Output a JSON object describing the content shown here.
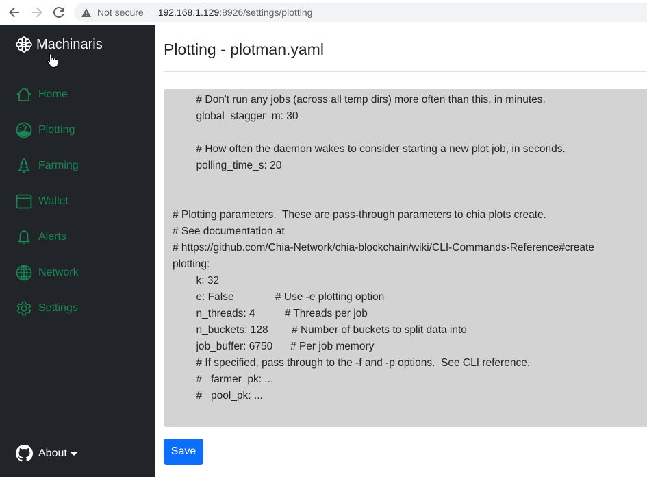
{
  "browser": {
    "security_label": "Not secure",
    "url_host": "192.168.1.129",
    "url_rest": ":8926/settings/plotting"
  },
  "sidebar": {
    "brand": "Machinaris",
    "items": [
      {
        "label": "Home",
        "icon": "house-icon"
      },
      {
        "label": "Plotting",
        "icon": "speedometer-icon"
      },
      {
        "label": "Farming",
        "icon": "tree-icon"
      },
      {
        "label": "Wallet",
        "icon": "wallet-icon"
      },
      {
        "label": "Alerts",
        "icon": "bell-icon"
      },
      {
        "label": "Network",
        "icon": "globe-icon"
      },
      {
        "label": "Settings",
        "icon": "gear-icon"
      }
    ],
    "about_label": "About",
    "accent_color": "#198754"
  },
  "main": {
    "title": "Plotting - plotman.yaml",
    "editor_lines": [
      "        # Don't run any jobs (across all temp dirs) more often than this, in minutes.",
      "        global_stagger_m: 30",
      "",
      "        # How often the daemon wakes to consider starting a new plot job, in seconds.",
      "        polling_time_s: 20",
      "",
      "",
      "# Plotting parameters.  These are pass-through parameters to chia plots create.",
      "# See documentation at",
      "# https://github.com/Chia-Network/chia-blockchain/wiki/CLI-Commands-Reference#create",
      "plotting:",
      "        k: 32",
      "        e: False              # Use -e plotting option",
      "        n_threads: 4          # Threads per job",
      "        n_buckets: 128        # Number of buckets to split data into",
      "        job_buffer: 6750      # Per job memory",
      "        # If specified, pass through to the -f and -p options.  See CLI reference.",
      "        #   farmer_pk: ...",
      "        #   pool_pk: ..."
    ],
    "save_label": "Save",
    "save_color": "#0d6efd"
  }
}
